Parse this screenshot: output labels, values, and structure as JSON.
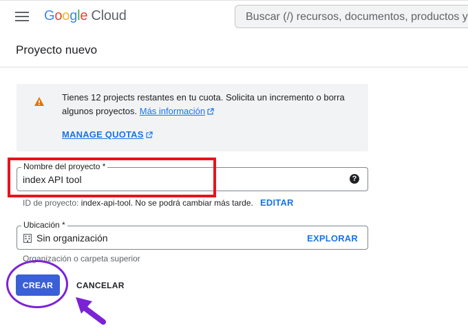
{
  "header": {
    "logo_letters": [
      "G",
      "o",
      "o",
      "g",
      "l",
      "e"
    ],
    "logo_product": "Cloud",
    "search_placeholder": "Buscar (/) recursos, documentos, productos y más"
  },
  "page": {
    "title": "Proyecto nuevo"
  },
  "info_box": {
    "text": "Tienes 12 projects restantes en tu cuota. Solicita un incremento o borra algunos proyectos.",
    "learn_more": "Más información",
    "manage_quotas": "MANAGE QUOTAS"
  },
  "project_name": {
    "label": "Nombre del proyecto *",
    "value": "index API tool",
    "help_icon": "?",
    "hint_prefix": "ID de proyecto:",
    "hint_id": "index-api-tool. No se podrá cambiar más tarde.",
    "edit": "EDITAR"
  },
  "location": {
    "label": "Ubicación *",
    "value": "Sin organización",
    "explore": "EXPLORAR",
    "hint": "Organización o carpeta superior"
  },
  "actions": {
    "create": "CREAR",
    "cancel": "CANCELAR"
  },
  "colors": {
    "accent": "#1a73e8",
    "create_button": "#3b5fd6",
    "highlight_red": "#e6141b",
    "highlight_purple": "#7b22d6",
    "warning": "#e37400"
  },
  "icons": [
    "menu-icon",
    "warning-icon",
    "external-link-icon",
    "help-icon",
    "building-icon",
    "arrow-icon"
  ]
}
